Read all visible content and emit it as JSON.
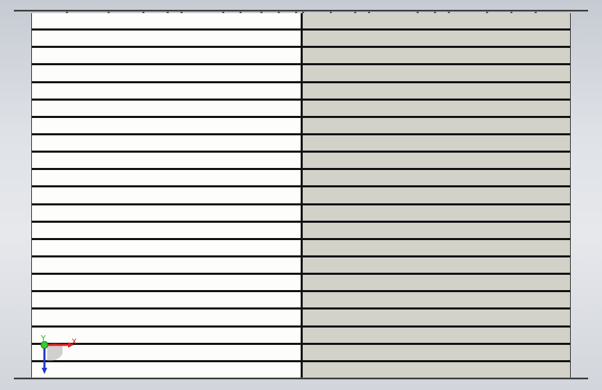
{
  "viewport": {
    "background_top": "#c6cad2",
    "background_bottom": "#d2d5db"
  },
  "model": {
    "row_count": 21,
    "left_face_color": "#fdfefb",
    "right_face_color": "#d3d2c9",
    "edge_color": "#111111"
  },
  "triad": {
    "x_axis_label": "X",
    "y_axis_label": "Y",
    "x_axis_color": "#dd2222",
    "y_axis_color": "#33aa33",
    "z_axis_color": "#2233cc"
  }
}
